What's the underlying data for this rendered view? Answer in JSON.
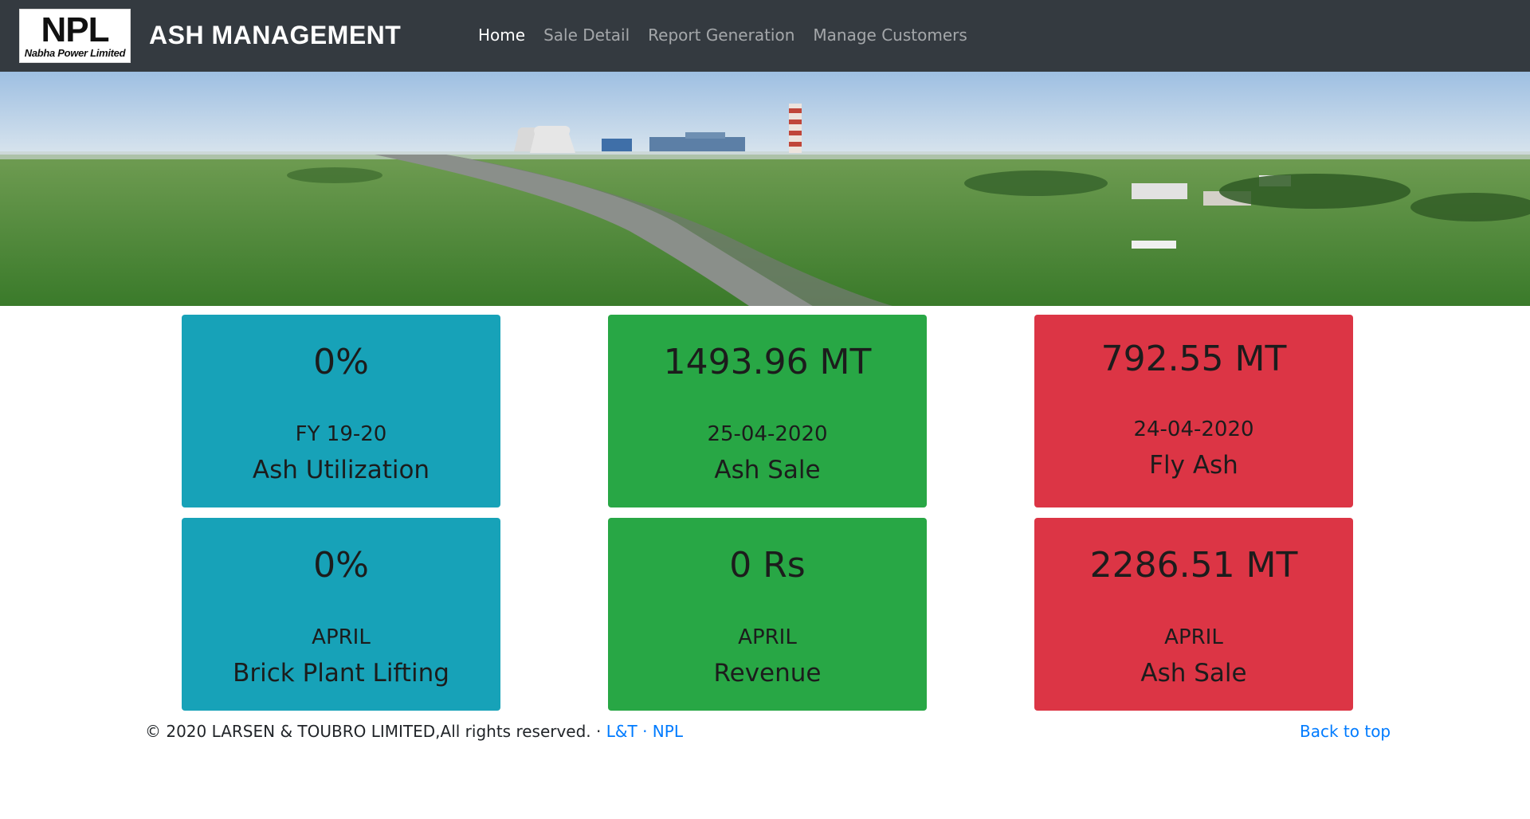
{
  "header": {
    "logo_mark": "NPL",
    "logo_subtitle": "Nabha Power Limited",
    "brand": "ASH MANAGEMENT",
    "nav": [
      {
        "label": "Home",
        "active": true
      },
      {
        "label": "Sale Detail",
        "active": false
      },
      {
        "label": "Report Generation",
        "active": false
      },
      {
        "label": "Manage Customers",
        "active": false
      }
    ]
  },
  "hero": {
    "description_icon": "power-plant-banner-image"
  },
  "cards": [
    {
      "value": "0%",
      "period": "FY 19-20",
      "label": "Ash Utilization",
      "color": "#17a2b8"
    },
    {
      "value": "1493.96 MT",
      "period": "25-04-2020",
      "label": "Ash Sale",
      "color": "#28a745"
    },
    {
      "value": "792.55 MT",
      "period": "24-04-2020",
      "label": "Fly Ash",
      "color": "#dc3545"
    },
    {
      "value": "0%",
      "period": "APRIL",
      "label": "Brick Plant Lifting",
      "color": "#17a2b8"
    },
    {
      "value": "0 Rs",
      "period": "APRIL",
      "label": "Revenue",
      "color": "#28a745"
    },
    {
      "value": "2286.51 MT",
      "period": "APRIL",
      "label": "Ash Sale",
      "color": "#dc3545"
    }
  ],
  "footer": {
    "copyright": "© 2020 LARSEN & TOUBRO LIMITED,All rights reserved. · ",
    "link_lt": "L&T",
    "separator": " · ",
    "link_npl": "NPL",
    "back_to_top": "Back to top"
  }
}
